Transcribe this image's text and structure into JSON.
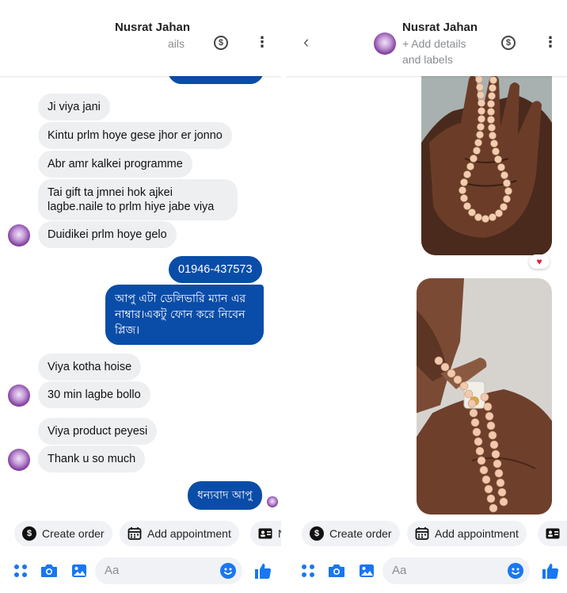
{
  "contact": {
    "name": "Nusrat Jahan",
    "subtitle_left": "ails",
    "subtitle_right_line1": "+ Add details",
    "subtitle_right_line2": "and labels"
  },
  "messages": [
    {
      "dir": "in",
      "text": "Ji viya jani"
    },
    {
      "dir": "in",
      "text": "Kintu prlm hoye gese jhor er jonno"
    },
    {
      "dir": "in",
      "text": "Abr amr kalkei programme"
    },
    {
      "dir": "in",
      "text": "Tai gift ta jmnei hok ajkei lagbe.naile to prlm hiye jabe viya"
    },
    {
      "dir": "in",
      "text": "Duidikei prlm hoye gelo"
    },
    {
      "dir": "out",
      "text": "01946-437573"
    },
    {
      "dir": "out",
      "text": "আপু এটা ডেলিভারি ম্যান এর নাম্বার।একটু ফোন  করে নিবেন প্লিজ।"
    },
    {
      "dir": "in",
      "text": "Viya kotha hoise"
    },
    {
      "dir": "in",
      "text": "30 min lagbe bollo"
    },
    {
      "dir": "in",
      "text": "Viya product peyesi"
    },
    {
      "dir": "in",
      "text": "Thank u so much"
    },
    {
      "dir": "out",
      "text": "ধন্যবাদ আপু"
    }
  ],
  "actions": {
    "create_order": "Create order",
    "add_appointment": "Add appointment",
    "more_left": "N",
    "more_right": ""
  },
  "composer": {
    "placeholder": "Aa"
  },
  "reactions": {
    "photo1": "heart"
  },
  "colors": {
    "outgoing_bubble": "#0a4da8",
    "incoming_bubble": "#eeeff1",
    "accent_blue": "#1877f2",
    "reaction_heart": "#e41e3f"
  },
  "icons": [
    "dollar-circle-icon",
    "more-vertical-icon",
    "back-chevron-icon",
    "apps-icon",
    "camera-icon",
    "gallery-icon",
    "emoji-icon",
    "thumbs-up-icon",
    "calendar-icon",
    "contact-card-icon",
    "heart-icon"
  ]
}
